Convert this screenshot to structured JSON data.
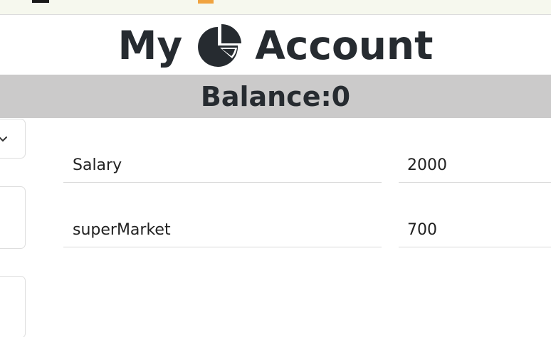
{
  "header": {
    "title_before": "My",
    "title_after": "Account"
  },
  "balance": {
    "label": "Balance:0"
  },
  "transactions": [
    {
      "name": "Salary",
      "amount": "2000"
    },
    {
      "name": "superMarket",
      "amount": "700"
    }
  ],
  "colors": {
    "balance_bar": "#cbcaca",
    "title_text": "#262b30"
  },
  "icons": {
    "title_icon": "pie-chart-icon",
    "dropdown_icon": "chevron-down-icon"
  }
}
